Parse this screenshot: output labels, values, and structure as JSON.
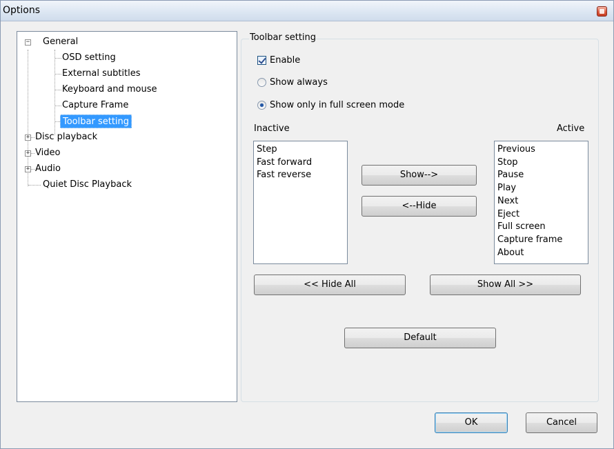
{
  "window": {
    "title": "Options"
  },
  "tree": {
    "general": "General",
    "general_children": [
      "OSD setting",
      "External subtitles",
      "Keyboard and mouse",
      "Capture Frame",
      "Toolbar setting"
    ],
    "disc_playback": "Disc playback",
    "video": "Video",
    "audio": "Audio",
    "quiet_disc_playback": "Quiet Disc Playback",
    "selected": "Toolbar setting"
  },
  "toolbar_setting": {
    "group_title": "Toolbar setting",
    "enable_label": "Enable",
    "enable_checked": true,
    "show_always_label": "Show always",
    "show_fullscreen_label": "Show only in full screen mode",
    "selected_mode": "Show only in full screen mode",
    "inactive_label": "Inactive",
    "active_label": "Active",
    "inactive_items": [
      "Step",
      "Fast forward",
      "Fast reverse"
    ],
    "active_items": [
      "Previous",
      "Stop",
      "Pause",
      "Play",
      "Next",
      "Eject",
      "Full screen",
      "Capture frame",
      "About"
    ],
    "show_button": "Show-->",
    "hide_button": "<--Hide",
    "hide_all_button": "<< Hide All",
    "show_all_button": "Show All >>",
    "default_button": "Default"
  },
  "footer": {
    "ok_button": "OK",
    "cancel_button": "Cancel"
  },
  "colors": {
    "selection": "#3399ff",
    "titlebar": "#dde7f3",
    "close_button": "#dd5b3f"
  }
}
